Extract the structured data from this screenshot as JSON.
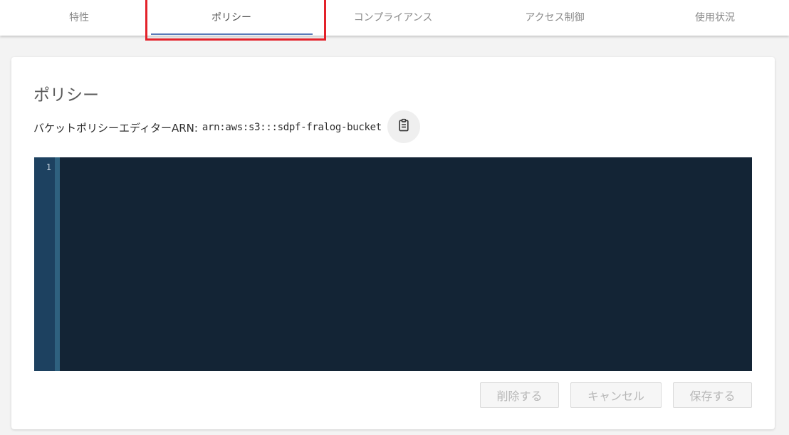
{
  "tabs": [
    {
      "label": "特性",
      "active": false
    },
    {
      "label": "ポリシー",
      "active": true
    },
    {
      "label": "コンプライアンス",
      "active": false
    },
    {
      "label": "アクセス制御",
      "active": false
    },
    {
      "label": "使用状況",
      "active": false
    }
  ],
  "card": {
    "title": "ポリシー",
    "arn_label": "バケットポリシーエディターARN:",
    "arn_value": "arn:aws:s3:::sdpf-fralog-bucket",
    "copy_icon": "clipboard-icon"
  },
  "editor": {
    "line_numbers": [
      "1"
    ],
    "content": ""
  },
  "buttons": {
    "delete_label": "削除する",
    "cancel_label": "キャンセル",
    "save_label": "保存する"
  },
  "colors": {
    "highlight": "#e3222a",
    "tab_underline": "#5a7ab8",
    "editor_bg": "#132435",
    "gutter_bg": "#1d4160"
  }
}
